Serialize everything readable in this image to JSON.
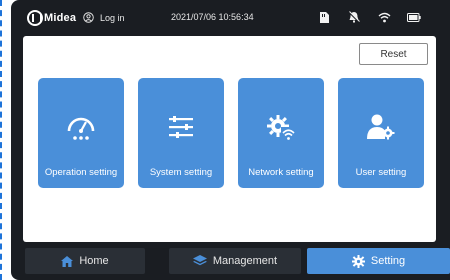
{
  "status_bar": {
    "brand": "Midea",
    "login_label": "Log in",
    "datetime": "2021/07/06  10:56:34",
    "icons": [
      "sd-card-icon",
      "alarm-muted-icon",
      "wifi-icon",
      "battery-icon"
    ]
  },
  "panel": {
    "reset_label": "Reset",
    "tiles": [
      {
        "label": "Operation setting",
        "icon": "gauge-icon"
      },
      {
        "label": "System setting",
        "icon": "sliders-icon"
      },
      {
        "label": "Network setting",
        "icon": "gear-wifi-icon"
      },
      {
        "label": "User setting",
        "icon": "user-gear-icon"
      }
    ]
  },
  "bottom_nav": {
    "items": [
      {
        "label": "Home",
        "icon": "home-icon",
        "active": false
      },
      {
        "label": "Management",
        "icon": "layers-icon",
        "active": false
      },
      {
        "label": "Setting",
        "icon": "gear-icon",
        "active": true
      }
    ]
  },
  "colors": {
    "background": "#1a1d22",
    "tile": "#4a8fd9",
    "active_nav": "#4a8fd9",
    "inactive_nav": "#2a2f36",
    "panel": "#ffffff"
  }
}
